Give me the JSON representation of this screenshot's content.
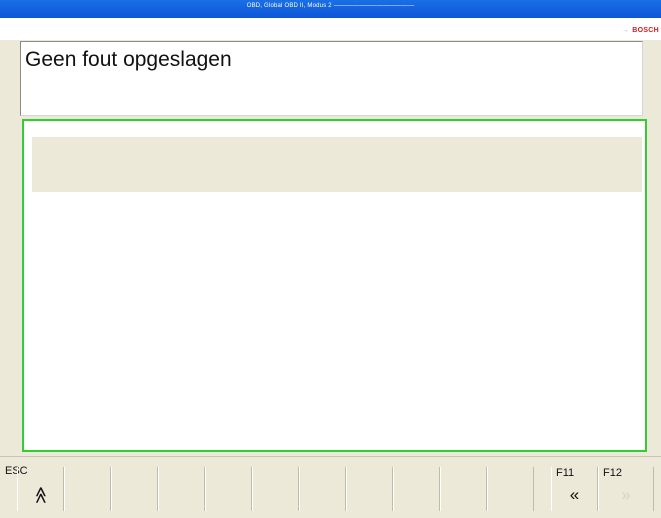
{
  "window": {
    "title_prefix": "OBD, Global OBD II, Modus 2",
    "title_suffix": "—————————————"
  },
  "brand": {
    "logo": "BOSCH",
    "logo_arrow": "→"
  },
  "message": {
    "text": "Geen fout opgeslagen"
  },
  "function_bar": {
    "keys": [
      {
        "label": "ESC",
        "icon": "double-up-chevron",
        "glyph": "≪",
        "enabled": true
      },
      {
        "label": "F11",
        "icon": "double-left-chevron",
        "glyph": "«",
        "enabled": true
      },
      {
        "label": "F12",
        "icon": "double-right-chevron",
        "glyph": "»",
        "enabled": false
      }
    ]
  },
  "colors": {
    "panel_border": "#33cc33",
    "titlebar": "#0d55d6",
    "background": "#ece9d8"
  }
}
